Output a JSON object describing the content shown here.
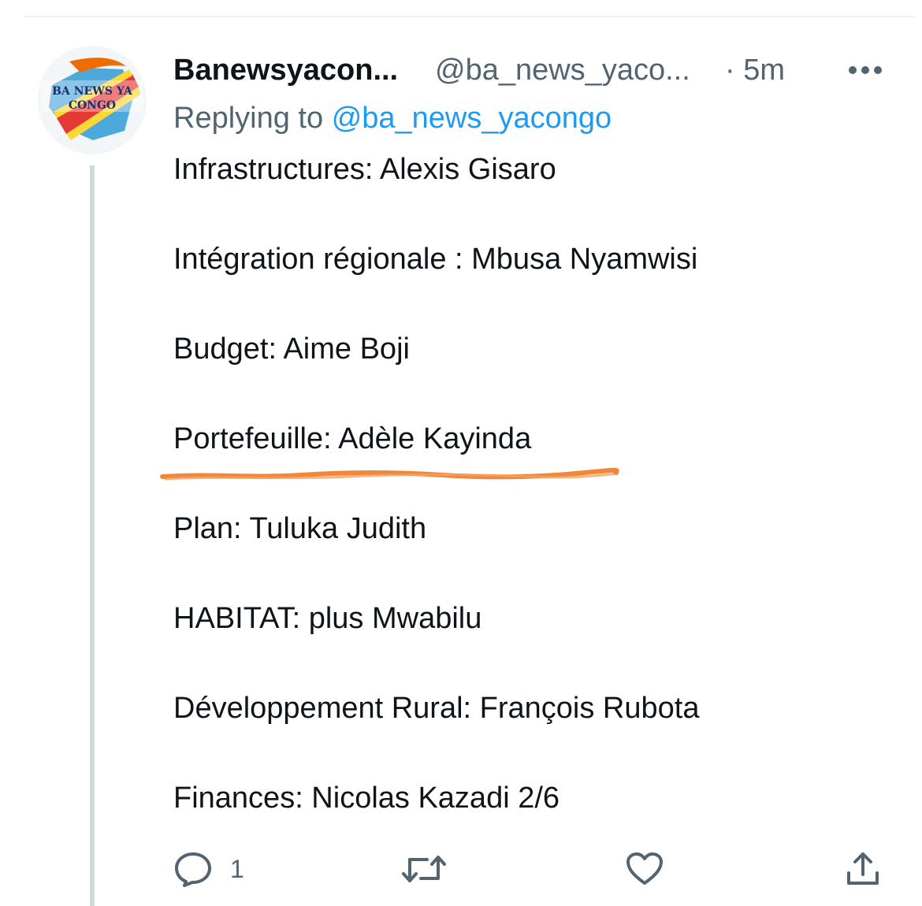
{
  "tweet": {
    "display_name": "Banewsyacon...",
    "handle": "@ba_news_yaco...",
    "time": "· 5m",
    "replying_label": "Replying to",
    "replying_to": "@ba_news_yacongo",
    "lines": [
      "Infrastructures: Alexis Gisaro",
      "Intégration régionale : Mbusa Nyamwisi",
      "Budget: Aime Boji",
      "Portefeuille: Adèle Kayinda",
      "Plan: Tuluka Judith",
      "HABITAT: plus Mwabilu",
      "Développement Rural: François Rubota",
      "Finances: Nicolas Kazadi 2/6"
    ],
    "avatar_text": [
      "BA NEWS YA",
      "CONGO"
    ]
  },
  "actions": {
    "reply_count": "1"
  },
  "icons": {
    "avatar": "news-logo-avatar",
    "more": "more-dots-icon",
    "reply": "reply-bubble-icon",
    "retweet": "retweet-icon",
    "like": "heart-icon",
    "share": "share-upload-icon"
  },
  "colors": {
    "text": "#0f1419",
    "muted": "#536471",
    "link": "#1d9bf0",
    "thread_line": "#cfd9de",
    "underline": "#f2873a"
  }
}
